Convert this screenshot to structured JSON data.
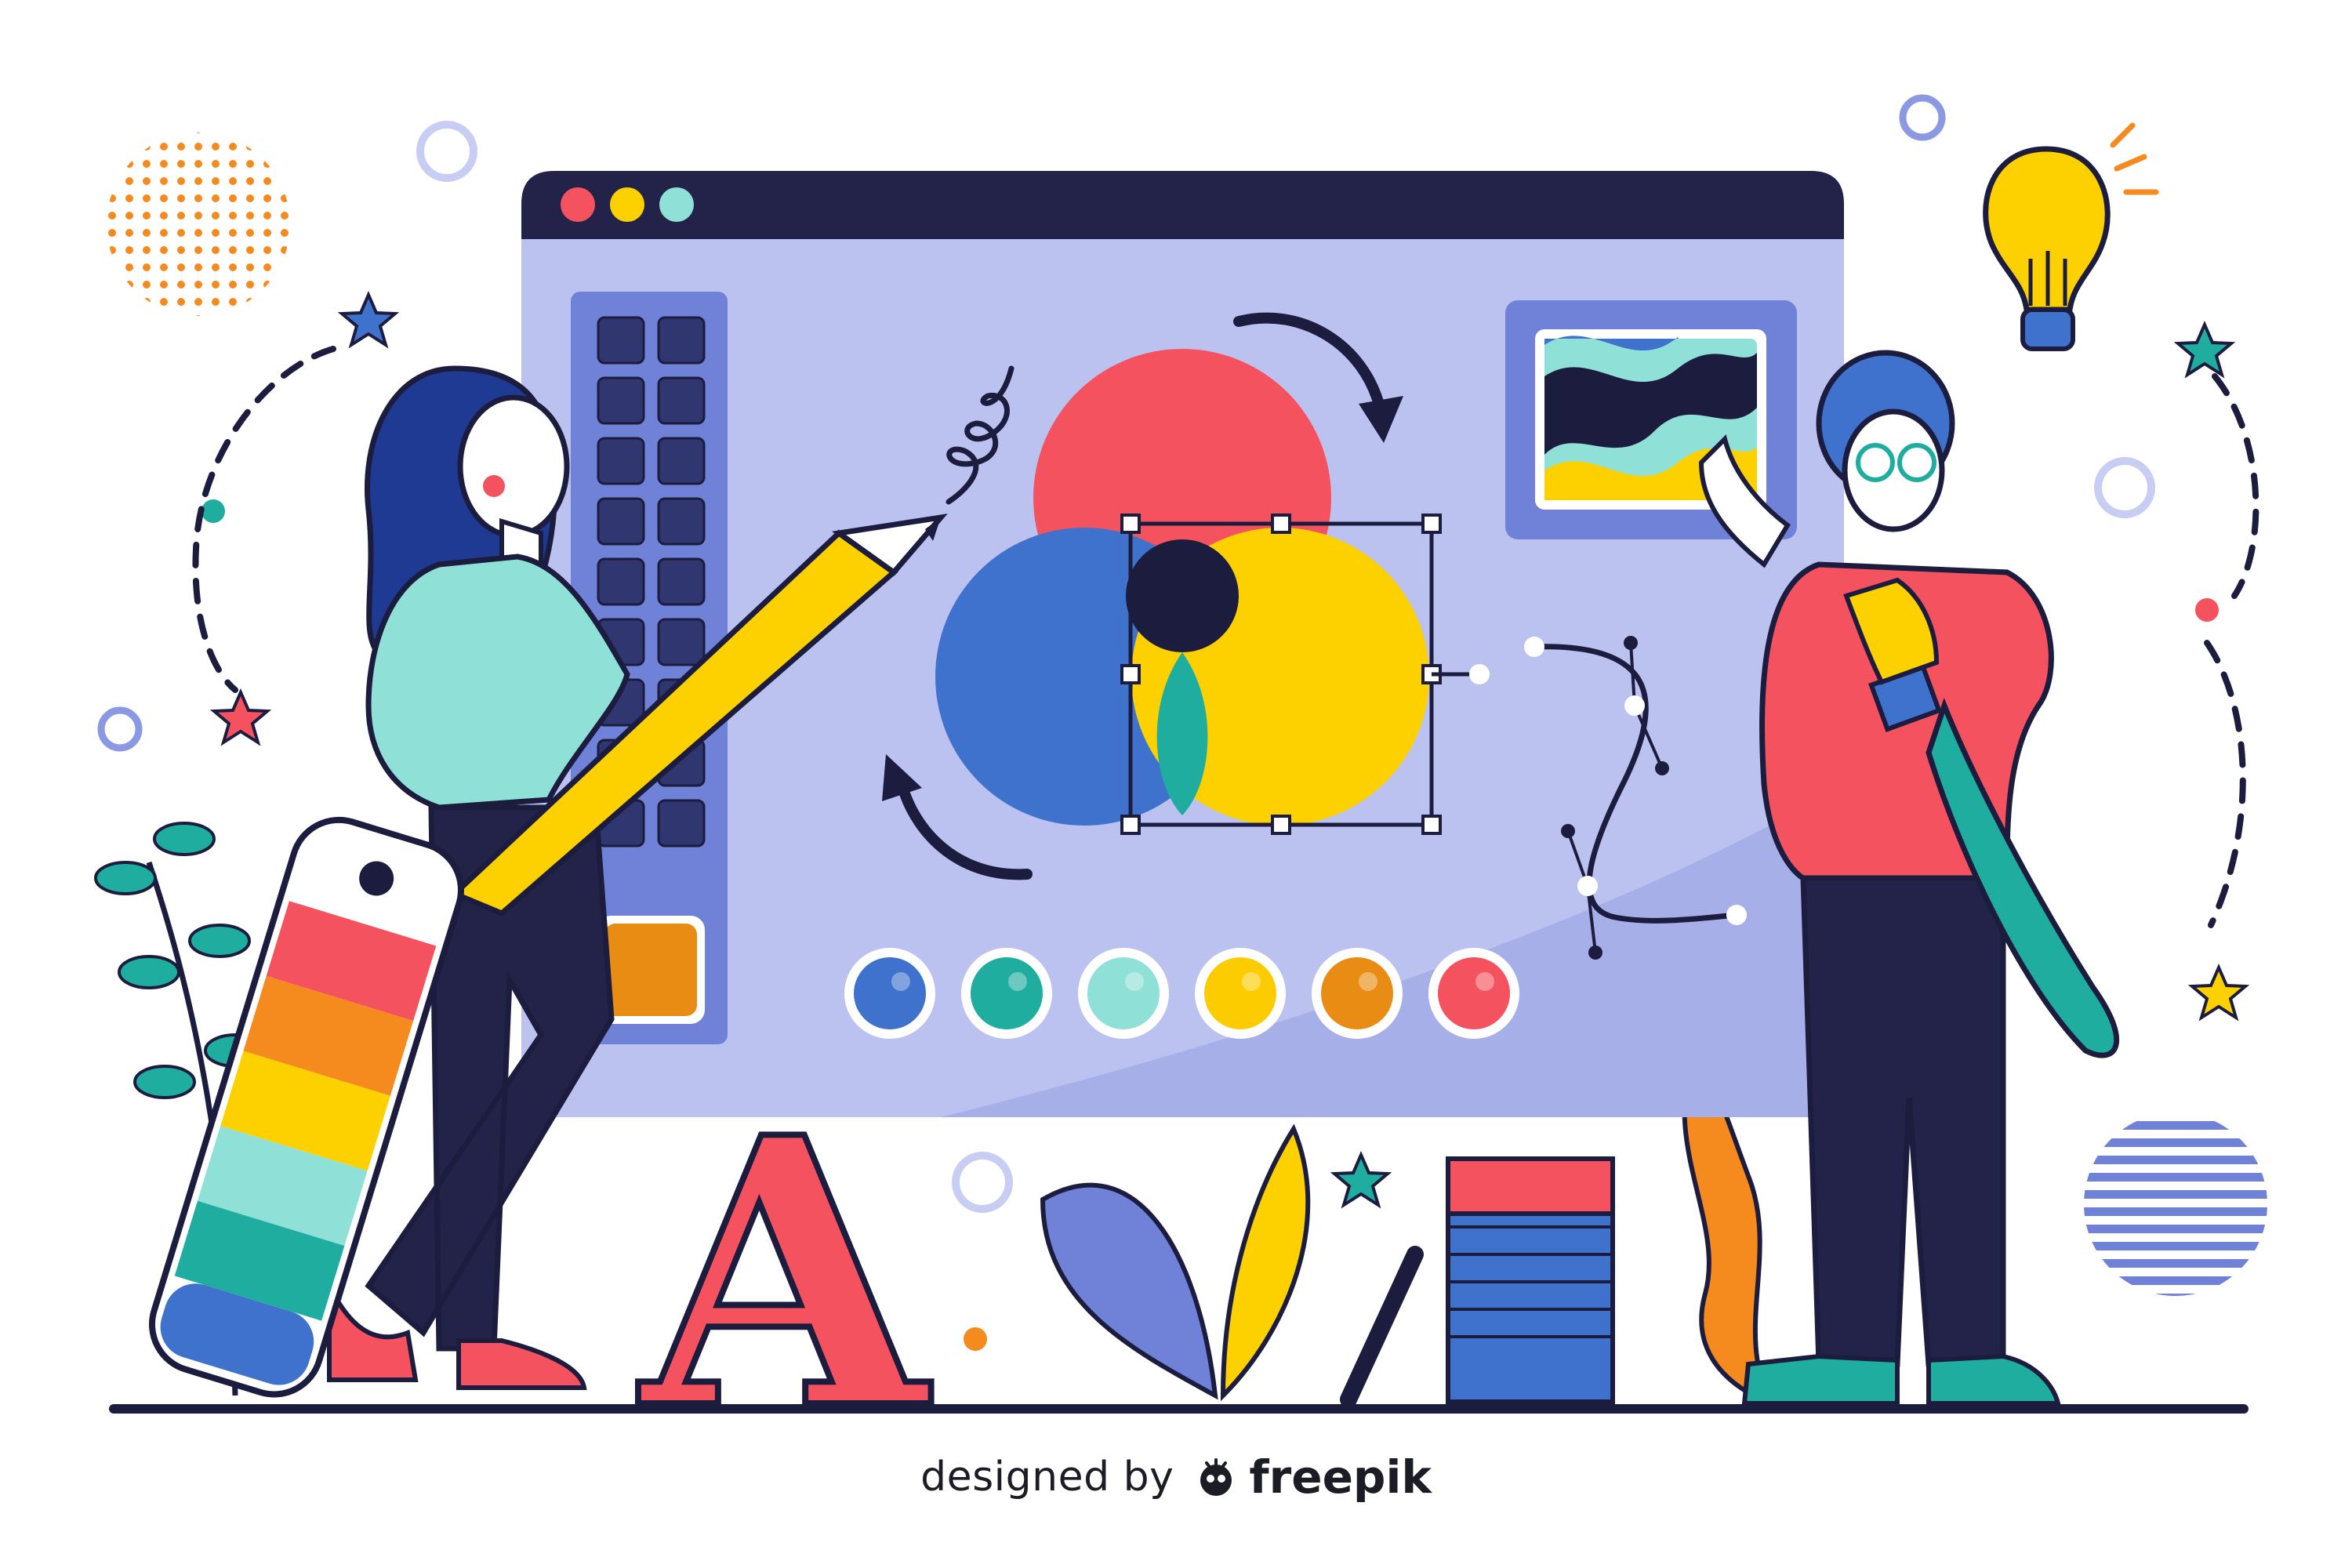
{
  "credit": {
    "prefix": "designed by",
    "brand": "freepik"
  },
  "illustration": {
    "letter": "A",
    "window_dots": [
      "#f5525f",
      "#fdd100",
      "#8fe0d6"
    ],
    "venn_colors": [
      "#f5525f",
      "#3f72cc",
      "#fdd100"
    ],
    "swatch_colors": [
      "#3f72cc",
      "#1fad9f",
      "#8fe0d6",
      "#fdcc00",
      "#e88c13",
      "#f5525f"
    ],
    "palette_colors": [
      "#f5525f",
      "#f58a1f",
      "#fdd100",
      "#8fe0d6",
      "#1fad9f",
      "#3f72cc"
    ],
    "outline": "#1c1c3f",
    "screen_bg": "#bbc2f0",
    "accent_teal": "#1fad9f"
  }
}
